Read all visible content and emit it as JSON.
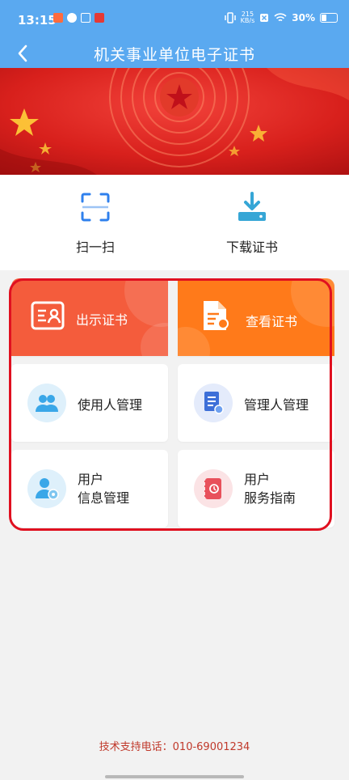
{
  "status_bar": {
    "time": "13:15",
    "network_speed_top": "215",
    "network_speed_bottom": "KB/s",
    "battery": "30%"
  },
  "navbar": {
    "title": "机关事业单位电子证书"
  },
  "quick_actions": [
    {
      "label": "扫一扫",
      "icon": "scan-icon"
    },
    {
      "label": "下载证书",
      "icon": "download-icon"
    }
  ],
  "menu": {
    "show_certificate": "出示证书",
    "view_certificate": "查看证书",
    "user_management": "使用人管理",
    "admin_management": "管理人管理",
    "user_info_line1": "用户",
    "user_info_line2": "信息管理",
    "service_line1": "用户",
    "service_line2": "服务指南"
  },
  "footer": {
    "support_phone": "技术支持电话：010-69001234"
  },
  "colors": {
    "header_blue": "#5aa9f0",
    "show_red": "#f45c3c",
    "view_orange": "#ff7a1a",
    "highlight_red": "#e01020"
  }
}
